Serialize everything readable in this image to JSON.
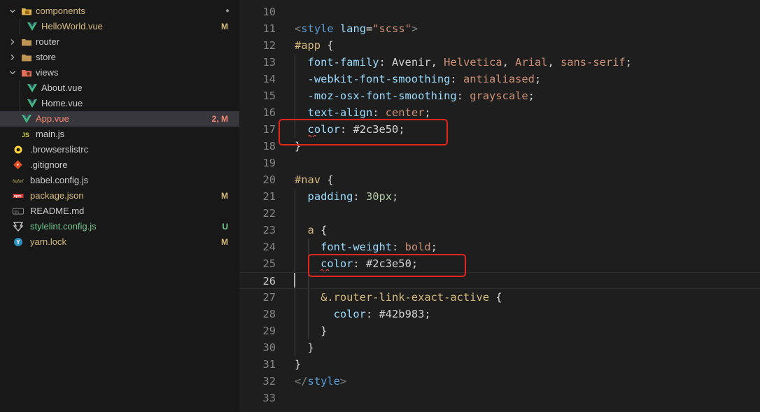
{
  "explorer": {
    "items": [
      {
        "label": "components",
        "icon": "folder-components-icon",
        "expanded": true,
        "badge": "●",
        "label_color": "#d7ba7d",
        "badge_color": "#8c8c8c"
      },
      {
        "label": "HelloWorld.vue",
        "icon": "vue-file-icon",
        "badge": "M",
        "label_color": "#d7ba7d",
        "badge_color": "#d7ba7d"
      },
      {
        "label": "router",
        "icon": "folder-icon",
        "expanded": false,
        "badge": "",
        "label_color": "#cccccc",
        "badge_color": ""
      },
      {
        "label": "store",
        "icon": "folder-icon",
        "expanded": false,
        "badge": "",
        "label_color": "#cccccc",
        "badge_color": ""
      },
      {
        "label": "views",
        "icon": "folder-views-icon",
        "expanded": true,
        "badge": "",
        "label_color": "#cccccc",
        "badge_color": ""
      },
      {
        "label": "About.vue",
        "icon": "vue-file-icon",
        "badge": "",
        "label_color": "#cccccc",
        "badge_color": ""
      },
      {
        "label": "Home.vue",
        "icon": "vue-file-icon",
        "badge": "",
        "label_color": "#cccccc",
        "badge_color": ""
      },
      {
        "label": "App.vue",
        "icon": "vue-file-icon",
        "badge": "2, M",
        "label_color": "#f48771",
        "badge_color": "#f48771",
        "selected": true
      },
      {
        "label": "main.js",
        "icon": "js-file-icon",
        "badge": "",
        "label_color": "#cccccc",
        "badge_color": ""
      },
      {
        "label": ".browserslistrc",
        "icon": "browserslist-icon",
        "badge": "",
        "label_color": "#cccccc",
        "badge_color": ""
      },
      {
        "label": ".gitignore",
        "icon": "git-icon",
        "badge": "",
        "label_color": "#cccccc",
        "badge_color": ""
      },
      {
        "label": "babel.config.js",
        "icon": "babel-icon",
        "badge": "",
        "label_color": "#cccccc",
        "badge_color": ""
      },
      {
        "label": "package.json",
        "icon": "npm-icon",
        "badge": "M",
        "label_color": "#d7ba7d",
        "badge_color": "#d7ba7d"
      },
      {
        "label": "README.md",
        "icon": "markdown-icon",
        "badge": "",
        "label_color": "#cccccc",
        "badge_color": ""
      },
      {
        "label": "stylelint.config.js",
        "icon": "stylelint-icon",
        "badge": "U",
        "label_color": "#73c991",
        "badge_color": "#73c991"
      },
      {
        "label": "yarn.lock",
        "icon": "yarn-icon",
        "badge": "M",
        "label_color": "#d7ba7d",
        "badge_color": "#d7ba7d"
      }
    ]
  },
  "editor": {
    "active_line": "26",
    "lines": [
      {
        "n": "10",
        "tokens": []
      },
      {
        "n": "11",
        "tokens": [
          [
            "tagbr",
            "<"
          ],
          [
            "tag",
            "style"
          ],
          [
            "punc",
            " "
          ],
          [
            "attr",
            "lang"
          ],
          [
            "punc",
            "="
          ],
          [
            "str",
            "\"scss\""
          ],
          [
            "tagbr",
            ">"
          ]
        ]
      },
      {
        "n": "12",
        "tokens": [
          [
            "sel",
            "#app"
          ],
          [
            "punc",
            " {"
          ]
        ]
      },
      {
        "n": "13",
        "tokens": [
          [
            "punc",
            "  "
          ],
          [
            "prop",
            "font-family"
          ],
          [
            "punc",
            ": Avenir, "
          ],
          [
            "val",
            "Helvetica"
          ],
          [
            "punc",
            ", "
          ],
          [
            "val",
            "Arial"
          ],
          [
            "punc",
            ", "
          ],
          [
            "val",
            "sans-serif"
          ],
          [
            "punc",
            ";"
          ]
        ]
      },
      {
        "n": "14",
        "tokens": [
          [
            "punc",
            "  "
          ],
          [
            "prop",
            "-webkit-font-smoothing"
          ],
          [
            "punc",
            ": "
          ],
          [
            "val",
            "antialiased"
          ],
          [
            "punc",
            ";"
          ]
        ]
      },
      {
        "n": "15",
        "tokens": [
          [
            "punc",
            "  "
          ],
          [
            "prop",
            "-moz-osx-font-smoothing"
          ],
          [
            "punc",
            ": "
          ],
          [
            "val",
            "grayscale"
          ],
          [
            "punc",
            ";"
          ]
        ]
      },
      {
        "n": "16",
        "tokens": [
          [
            "punc",
            "  "
          ],
          [
            "prop",
            "text-align"
          ],
          [
            "punc",
            ": "
          ],
          [
            "val",
            "center"
          ],
          [
            "punc",
            ";"
          ]
        ]
      },
      {
        "n": "17",
        "tokens": [
          [
            "punc",
            "  "
          ],
          [
            "prop",
            "color"
          ],
          [
            "punc",
            ": "
          ],
          [
            "punc",
            "#2c3e50"
          ],
          [
            "punc",
            ";"
          ]
        ]
      },
      {
        "n": "18",
        "tokens": [
          [
            "punc",
            "}"
          ]
        ]
      },
      {
        "n": "19",
        "tokens": []
      },
      {
        "n": "20",
        "tokens": [
          [
            "sel",
            "#nav"
          ],
          [
            "punc",
            " {"
          ]
        ]
      },
      {
        "n": "21",
        "tokens": [
          [
            "punc",
            "  "
          ],
          [
            "prop",
            "padding"
          ],
          [
            "punc",
            ": "
          ],
          [
            "num",
            "30px"
          ],
          [
            "punc",
            ";"
          ]
        ]
      },
      {
        "n": "22",
        "tokens": []
      },
      {
        "n": "23",
        "tokens": [
          [
            "punc",
            "  "
          ],
          [
            "sel",
            "a"
          ],
          [
            "punc",
            " {"
          ]
        ]
      },
      {
        "n": "24",
        "tokens": [
          [
            "punc",
            "    "
          ],
          [
            "prop",
            "font-weight"
          ],
          [
            "punc",
            ": "
          ],
          [
            "val",
            "bold"
          ],
          [
            "punc",
            ";"
          ]
        ]
      },
      {
        "n": "25",
        "tokens": [
          [
            "punc",
            "    "
          ],
          [
            "prop",
            "color"
          ],
          [
            "punc",
            ": "
          ],
          [
            "punc",
            "#2c3e50"
          ],
          [
            "punc",
            ";"
          ]
        ]
      },
      {
        "n": "26",
        "tokens": []
      },
      {
        "n": "27",
        "tokens": [
          [
            "punc",
            "    "
          ],
          [
            "sel",
            "&.router-link-exact-active"
          ],
          [
            "punc",
            " {"
          ]
        ]
      },
      {
        "n": "28",
        "tokens": [
          [
            "punc",
            "      "
          ],
          [
            "prop",
            "color"
          ],
          [
            "punc",
            ": "
          ],
          [
            "punc",
            "#42b983"
          ],
          [
            "punc",
            ";"
          ]
        ]
      },
      {
        "n": "29",
        "tokens": [
          [
            "punc",
            "    }"
          ]
        ]
      },
      {
        "n": "30",
        "tokens": [
          [
            "punc",
            "  }"
          ]
        ]
      },
      {
        "n": "31",
        "tokens": [
          [
            "punc",
            "}"
          ]
        ]
      },
      {
        "n": "32",
        "tokens": [
          [
            "tagbr",
            "</"
          ],
          [
            "tag",
            "style"
          ],
          [
            "tagbr",
            ">"
          ]
        ]
      },
      {
        "n": "33",
        "tokens": []
      }
    ]
  },
  "annotation_color": "#e0261f"
}
